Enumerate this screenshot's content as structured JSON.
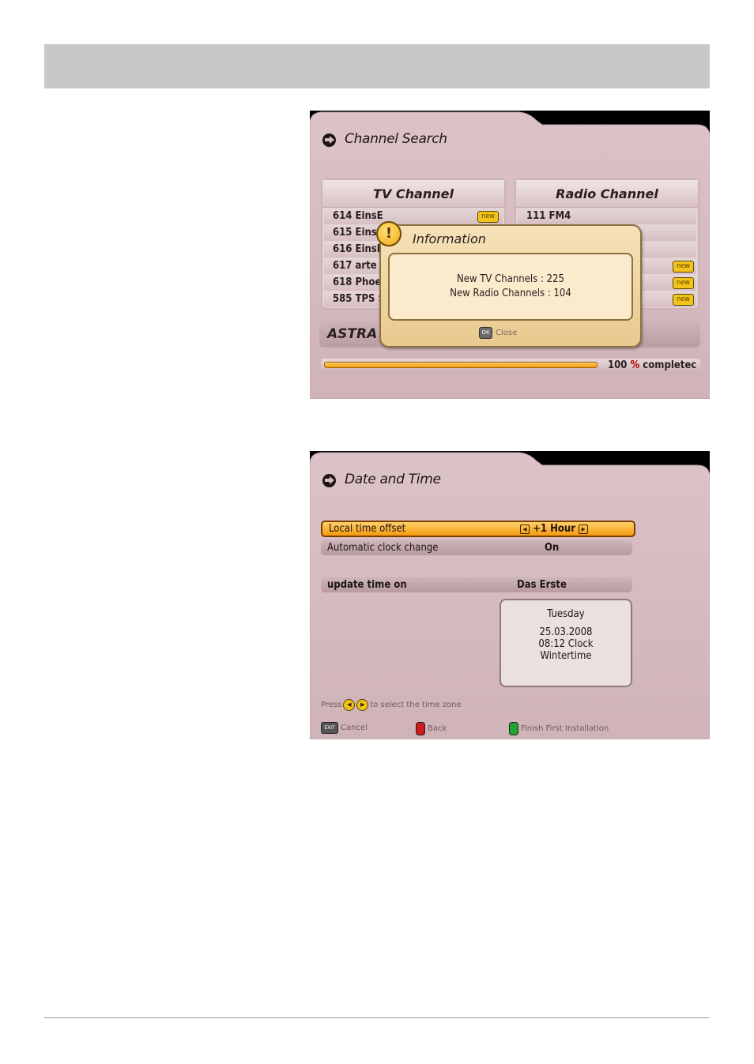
{
  "channel_search": {
    "title": "Channel Search",
    "tv_header": "TV Channel",
    "radio_header": "Radio Channel",
    "tv_rows": [
      "614 EinsE",
      "615 EinsF",
      "616 EinsP",
      "617 arte",
      "618 Phoe",
      "585 TPS S"
    ],
    "radio_rows": [
      "111 FM4",
      "",
      "",
      "",
      "",
      ""
    ],
    "new_badge": "new",
    "satellite": "ASTRA 1",
    "progress_value": "100",
    "progress_unit": "%",
    "progress_suffix": "completec",
    "progress_percent": 100,
    "dialog": {
      "title": "Information",
      "line1": "New TV Channels : 225",
      "line2": "New Radio Channels : 104",
      "ok_key": "OK",
      "close_label": "Close"
    }
  },
  "date_time": {
    "title": "Date and Time",
    "rows": [
      {
        "label": "Local time offset",
        "value": "+1 Hour"
      },
      {
        "label": "Automatic clock change",
        "value": "On"
      },
      {
        "label": "update time on",
        "value": "Das Erste"
      }
    ],
    "day": "Tuesday",
    "date": "25.03.2008",
    "time": "08:12 Clock",
    "season": "Wintertime",
    "hint_press": "Press",
    "hint_rest": "to select the time zone",
    "exit_key": "EXIT",
    "cancel_label": "Cancel",
    "back_label": "Back",
    "finish_label": "Finish First Installation"
  },
  "colors": {
    "screen_pink": "#d7bcc0",
    "accent_orange": "#f59b10",
    "badge_yellow": "#f3c21b",
    "red_key": "#d11a1a",
    "green_key": "#1aa534"
  }
}
